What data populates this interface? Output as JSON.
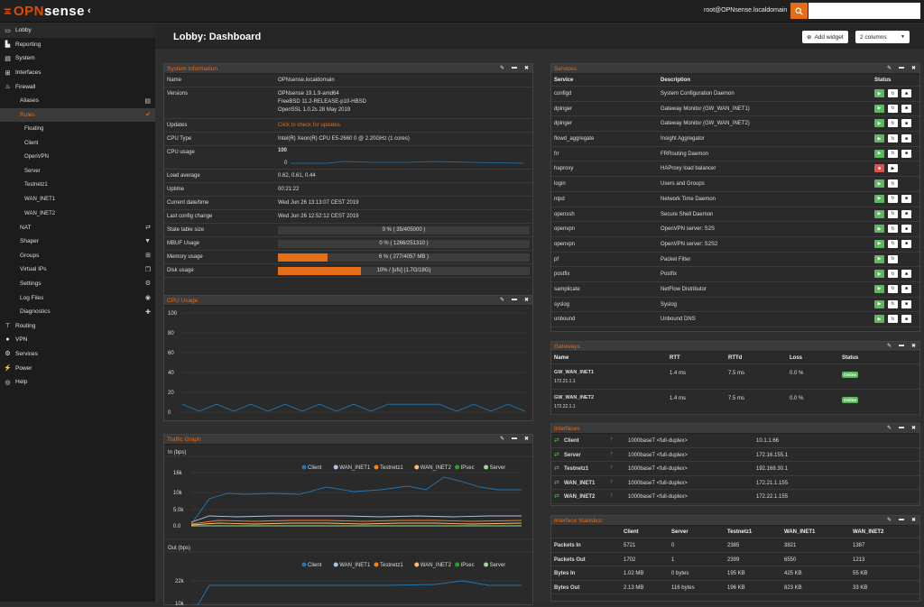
{
  "top": {
    "brand_prefix": "OPN",
    "brand_suffix": "sense",
    "user": "root@OPNsense.localdomain",
    "search_placeholder": ""
  },
  "sidebar": {
    "lobby": "Lobby",
    "reporting": "Reporting",
    "system": "System",
    "interfaces": "Interfaces",
    "firewall": "Firewall",
    "aliases": "Aliases",
    "rules": "Rules",
    "rules_sub": [
      "Floating",
      "Client",
      "OpenVPN",
      "Server",
      "Testnetz1",
      "WAN_INET1",
      "WAN_INET2"
    ],
    "nat": "NAT",
    "shaper": "Shaper",
    "groups": "Groups",
    "virtual_ips": "Virtual IPs",
    "settings": "Settings",
    "log_files": "Log Files",
    "diagnostics": "Diagnostics",
    "routing": "Routing",
    "vpn": "VPN",
    "services": "Services",
    "power": "Power",
    "help": "Help"
  },
  "header": {
    "title": "Lobby: Dashboard",
    "add_widget": "Add widget",
    "columns": "2 columns"
  },
  "sysinfo": {
    "title": "System Information",
    "rows": [
      {
        "k": "Name",
        "v": "OPNsense.localdomain"
      },
      {
        "k": "Versions",
        "v1": "OPNsense 19.1.9-amd64",
        "v2": "FreeBSD 11.2-RELEASE-p10-HBSD",
        "v3": "OpenSSL 1.0.2s 28 May 2019"
      },
      {
        "k": "Updates",
        "v": "Click to check for updates."
      },
      {
        "k": "CPU Type",
        "v": "Intel(R) Xeon(R) CPU E5-2660 0 @ 2.20GHz (1 cores)"
      },
      {
        "k": "CPU usage",
        "v": ""
      },
      {
        "k": "Load average",
        "v": "0.62, 0.61, 0.44"
      },
      {
        "k": "Uptime",
        "v": "00:21:22"
      },
      {
        "k": "Current date/time",
        "v": "Wed Jun 26 13:13:07 CEST 2019"
      },
      {
        "k": "Last config change",
        "v": "Wed Jun 26 12:52:12 CEST 2019"
      },
      {
        "k": "State table size",
        "v": "0 % ( 35/405000 )",
        "pct": 0
      },
      {
        "k": "MBUF Usage",
        "v": "0 % ( 1266/251310 )",
        "pct": 0
      },
      {
        "k": "Memory usage",
        "v": "6 % ( 277/4057 MB )",
        "pct": 6
      },
      {
        "k": "Disk usage",
        "v": "10% / [ufs] (1.7G/18G)",
        "pct": 10
      }
    ],
    "cpu_spark_max": "100",
    "cpu_spark_min": "0"
  },
  "cpu": {
    "title": "CPU Usage",
    "yticks": [
      "100",
      "80",
      "60",
      "40",
      "20",
      "0"
    ],
    "series": [
      8,
      1,
      8,
      1,
      8,
      1,
      8,
      1,
      8,
      1,
      8,
      1,
      8,
      8,
      8,
      8,
      1,
      8,
      1,
      8,
      1
    ]
  },
  "traffic": {
    "title": "Traffic Graph",
    "in_label": "In (bps)",
    "out_label": "Out (bps)",
    "legend": [
      {
        "name": "Client",
        "color": "#1f77b4"
      },
      {
        "name": "WAN_INET1",
        "color": "#aec7e8"
      },
      {
        "name": "Testnetz1",
        "color": "#ff7f0e"
      },
      {
        "name": "WAN_INET2",
        "color": "#ffbb78"
      },
      {
        "name": "IPsec",
        "color": "#2ca02c"
      },
      {
        "name": "Server",
        "color": "#98df8a"
      }
    ],
    "in_ticks": [
      "16k",
      "10k",
      "5.0k",
      "0.0"
    ],
    "out_ticks": [
      "22k",
      "10k"
    ]
  },
  "services": {
    "title": "Services",
    "h_service": "Service",
    "h_desc": "Description",
    "h_status": "Status",
    "rows": [
      {
        "s": "configd",
        "d": "System Configuration Daemon",
        "st": "run",
        "r": true
      },
      {
        "s": "dpinger",
        "d": "Gateway Monitor (GW_WAN_INET1)",
        "st": "run",
        "r": true
      },
      {
        "s": "dpinger",
        "d": "Gateway Monitor (GW_WAN_INET2)",
        "st": "run",
        "r": true
      },
      {
        "s": "flowd_aggregate",
        "d": "Insight Aggregator",
        "st": "run",
        "r": true
      },
      {
        "s": "frr",
        "d": "FRRouting Daemon",
        "st": "run",
        "r": true
      },
      {
        "s": "haproxy",
        "d": "HAProxy load balancer",
        "st": "stop",
        "r": false
      },
      {
        "s": "login",
        "d": "Users and Groups",
        "st": "run",
        "r": false
      },
      {
        "s": "ntpd",
        "d": "Network Time Daemon",
        "st": "run",
        "r": true
      },
      {
        "s": "openssh",
        "d": "Secure Shell Daemon",
        "st": "run",
        "r": true
      },
      {
        "s": "openvpn",
        "d": "OpenVPN server: S2S",
        "st": "run",
        "r": true
      },
      {
        "s": "openvpn",
        "d": "OpenVPN server: S2S2",
        "st": "run",
        "r": true
      },
      {
        "s": "pf",
        "d": "Packet Filter",
        "st": "run",
        "r": false
      },
      {
        "s": "postfix",
        "d": "Postfix",
        "st": "run",
        "r": true
      },
      {
        "s": "samplicate",
        "d": "NetFlow Distributor",
        "st": "run",
        "r": true
      },
      {
        "s": "syslog",
        "d": "Syslog",
        "st": "run",
        "r": true
      },
      {
        "s": "unbound",
        "d": "Unbound DNS",
        "st": "run",
        "r": true
      }
    ]
  },
  "gateways": {
    "title": "Gateways",
    "h": [
      "Name",
      "RTT",
      "RTTd",
      "Loss",
      "Status"
    ],
    "rows": [
      {
        "n": "GW_WAN_INET1",
        "ip": "172.21.1.1",
        "rtt": "1.4 ms",
        "rttd": "7.5 ms",
        "loss": "0.0 %",
        "status": "Online"
      },
      {
        "n": "GW_WAN_INET2",
        "ip": "172.22.1.1",
        "rtt": "1.4 ms",
        "rttd": "7.5 ms",
        "loss": "0.0 %",
        "status": "Online"
      }
    ]
  },
  "interfaces": {
    "title": "Interfaces",
    "rows": [
      {
        "n": "Client",
        "m": "1000baseT <full-duplex>",
        "ip": "10.1.1.66"
      },
      {
        "n": "Server",
        "m": "1000baseT <full-duplex>",
        "ip": "172.16.155.1"
      },
      {
        "n": "Testnetz1",
        "m": "1000baseT <full-duplex>",
        "ip": "192.168.30.1"
      },
      {
        "n": "WAN_INET1",
        "m": "1000baseT <full-duplex>",
        "ip": "172.21.1.155"
      },
      {
        "n": "WAN_INET2",
        "m": "1000baseT <full-duplex>",
        "ip": "172.22.1.155"
      }
    ]
  },
  "ifstats": {
    "title": "Interface Statistics",
    "h": [
      "Client",
      "Server",
      "Testnetz1",
      "WAN_INET1",
      "WAN_INET2"
    ],
    "rows": [
      {
        "k": "Packets In",
        "v": [
          "5721",
          "0",
          "2385",
          "3821",
          "1387"
        ]
      },
      {
        "k": "Packets Out",
        "v": [
          "1702",
          "1",
          "2399",
          "6550",
          "1213"
        ]
      },
      {
        "k": "Bytes In",
        "v": [
          "1.02 MB",
          "0 bytes",
          "195 KB",
          "425 KB",
          "55 KB"
        ]
      },
      {
        "k": "Bytes Out",
        "v": [
          "2.13 MB",
          "116 bytes",
          "196 KB",
          "823 KB",
          "33 KB"
        ]
      }
    ]
  }
}
